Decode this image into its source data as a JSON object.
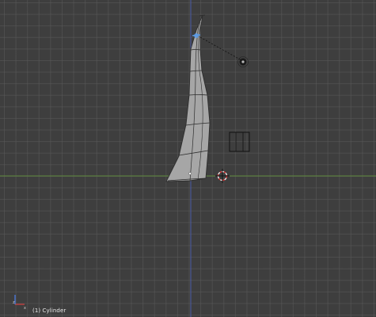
{
  "viewport": {
    "object_label": "(1) Cylinder",
    "grid_color": "#5a5a5a",
    "background_color": "#3e3e3e",
    "x_axis_color": "#5e8a3c",
    "z_axis_color": "#4a5aa6",
    "mesh_fill_color": "#a6a6a6",
    "mesh_edge_color": "#2a2a2a",
    "selected_vertex_color": "#5b9be8"
  },
  "icons": {
    "lamp": "lamp-icon",
    "camera": "camera-icon",
    "cursor": "3d-cursor-icon",
    "axes": "axes-gizmo-icon",
    "origin": "object-origin-icon"
  }
}
